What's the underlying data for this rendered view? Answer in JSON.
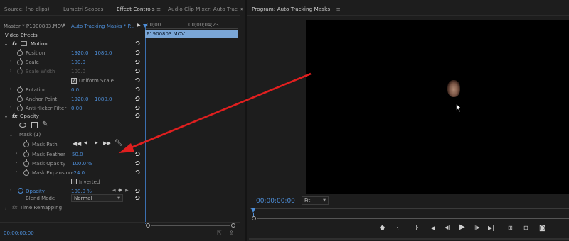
{
  "tabs": {
    "source": "Source: (no clips)",
    "lumetri": "Lumetri Scopes",
    "effect_controls": "Effect Controls",
    "audio_mixer": "Audio Clip Mixer: Auto Trac",
    "program": "Program: Auto Tracking Masks"
  },
  "header": {
    "master": "Master * P1900803.MOV",
    "sequence": "Auto Tracking Masks * P..."
  },
  "timeline": {
    "timecode_start": "00;00",
    "timecode_end": "00;00;04;23",
    "clip_label": "P1900803.MOV"
  },
  "effects": {
    "section_title": "Video Effects",
    "motion": {
      "label": "Motion",
      "position_label": "Position",
      "position_x": "1920.0",
      "position_y": "1080.0",
      "scale_label": "Scale",
      "scale_value": "100.0",
      "scale_width_label": "Scale Width",
      "scale_width_value": "100.0",
      "uniform_scale_label": "Uniform Scale",
      "rotation_label": "Rotation",
      "rotation_value": "0.0",
      "anchor_label": "Anchor Point",
      "anchor_x": "1920.0",
      "anchor_y": "1080.0",
      "flicker_label": "Anti-flicker Filter",
      "flicker_value": "0.00"
    },
    "opacity": {
      "label": "Opacity",
      "mask_label": "Mask (1)",
      "mask_path_label": "Mask Path",
      "mask_feather_label": "Mask Feather",
      "mask_feather_value": "50.0",
      "mask_opacity_label": "Mask Opacity",
      "mask_opacity_value": "100.0 %",
      "mask_expansion_label": "Mask Expansion",
      "mask_expansion_value": "-24.0",
      "inverted_label": "Inverted",
      "opacity_label": "Opacity",
      "opacity_value": "100.0 %",
      "blend_mode_label": "Blend Mode",
      "blend_mode_value": "Normal"
    },
    "time_remapping_label": "Time Remapping"
  },
  "footer": {
    "timecode": "00:00:00:00"
  },
  "program": {
    "timecode": "00:00:00:00",
    "fit_label": "Fit"
  },
  "colors": {
    "accent_blue": "#4d8ed8",
    "arrow_red": "#e01f1f",
    "panel_bg": "#1d1d1d",
    "video_bg": "#000000"
  }
}
